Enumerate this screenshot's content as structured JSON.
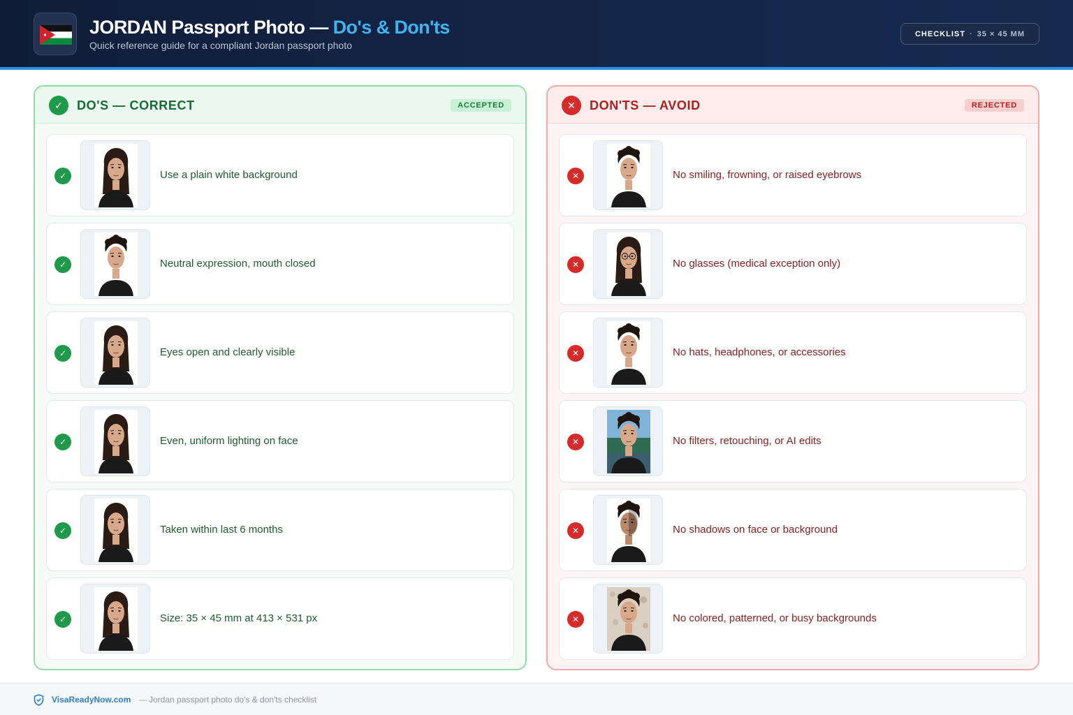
{
  "header": {
    "title_main": "JORDAN Passport Photo — ",
    "title_accent": "Do's & Don'ts",
    "subtitle": "Quick reference guide for a compliant Jordan passport photo",
    "pill_label": "CHECKLIST",
    "pill_sep": "·",
    "pill_size": "35 × 45 MM",
    "flag_icon": "jordan-flag-icon",
    "colors": {
      "accent": "#3fb4f0",
      "header_bg": "#0f1d38",
      "header_line": "#2c8ee0"
    }
  },
  "dos": {
    "title": "DO'S — CORRECT",
    "badge": "ACCEPTED",
    "icon": "check-icon",
    "color": "#1f9a4a",
    "items": [
      {
        "text": "Use a plain white background"
      },
      {
        "text": "Neutral expression, mouth closed"
      },
      {
        "text": "Eyes open and clearly visible"
      },
      {
        "text": "Even, uniform lighting on face"
      },
      {
        "text": "Taken within last 6 months"
      },
      {
        "text": "Size: 35 × 45 mm at 413 × 531 px"
      }
    ]
  },
  "donts": {
    "title": "DON'TS — AVOID",
    "badge": "REJECTED",
    "icon": "x-icon",
    "color": "#d52b2b",
    "items": [
      {
        "text": "No smiling, frowning, or raised eyebrows"
      },
      {
        "text": "No glasses (medical exception only)"
      },
      {
        "text": "No hats, headphones, or accessories"
      },
      {
        "text": "No filters, retouching, or AI edits"
      },
      {
        "text": "No shadows on face or background"
      },
      {
        "text": "No colored, patterned, or busy backgrounds"
      }
    ]
  },
  "footer": {
    "brand": "VisaReadyNow.com",
    "sep": "—",
    "text": "Jordan passport photo do's & don'ts checklist",
    "icon": "shield-icon"
  }
}
